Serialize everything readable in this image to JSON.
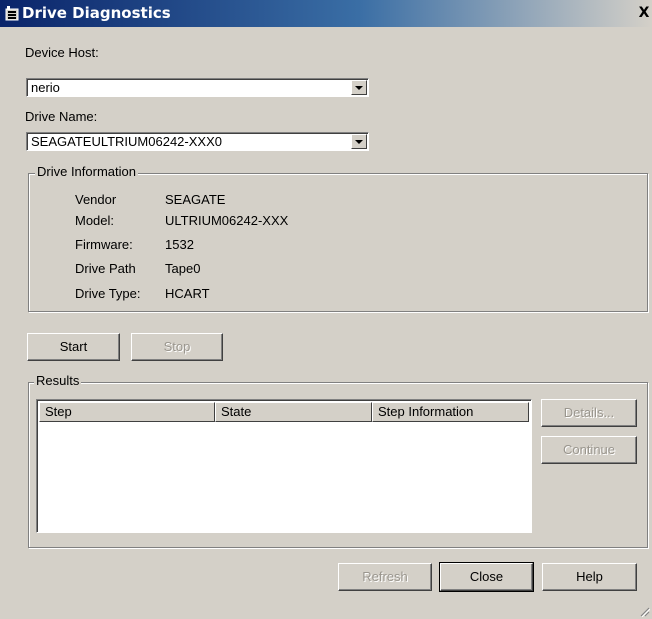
{
  "window": {
    "title": "Drive Diagnostics",
    "close_glyph": "X",
    "icon": "drive-diagnostics-app-icon"
  },
  "device_host": {
    "label": "Device Host:",
    "value": "nerio"
  },
  "drive_name": {
    "label": "Drive Name:",
    "value": "SEAGATEULTRIUM06242-XXX0"
  },
  "drive_information": {
    "title": "Drive Information",
    "rows": [
      {
        "label": "Vendor",
        "value": "SEAGATE"
      },
      {
        "label": "Model:",
        "value": "ULTRIUM06242-XXX"
      },
      {
        "label": "Firmware:",
        "value": "1532"
      },
      {
        "label": "Drive Path",
        "value": "Tape0"
      },
      {
        "label": "Drive Type:",
        "value": "HCART"
      }
    ]
  },
  "controls": {
    "start_label": "Start",
    "stop_label": "Stop"
  },
  "results": {
    "title": "Results",
    "columns": [
      "Step",
      "State",
      "Step Information"
    ],
    "details_label": "Details...",
    "continue_label": "Continue"
  },
  "footer": {
    "refresh_label": "Refresh",
    "close_label": "Close",
    "help_label": "Help"
  }
}
